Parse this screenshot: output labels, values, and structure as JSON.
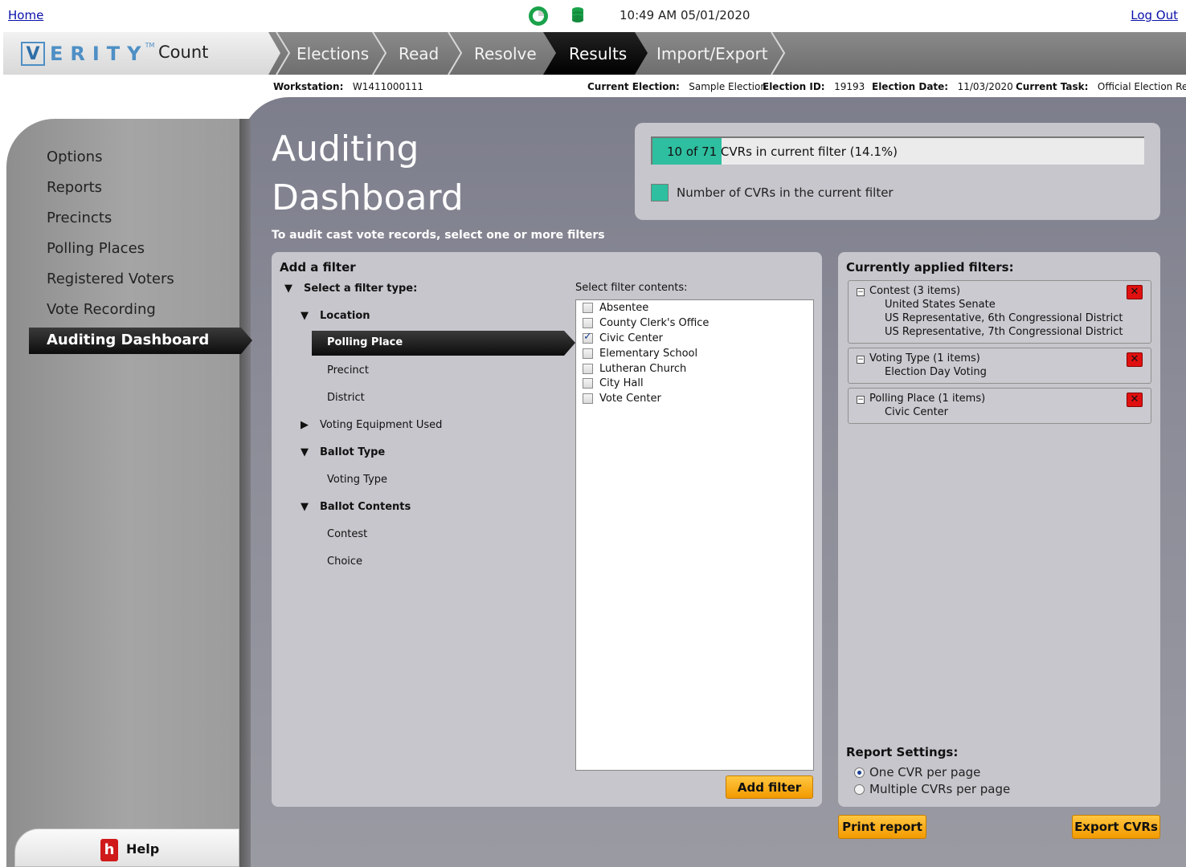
{
  "top": {
    "home_link": "Home",
    "logout_link": "Log Out",
    "clock": "10:49 AM 05/01/2020",
    "sync_icon": "sync-status-icon",
    "db_icon": "database-icon"
  },
  "brand": {
    "logo_letter": "V",
    "logo_rest": "ERITY",
    "logo_tm": "TM",
    "product": "Count"
  },
  "tabs": [
    {
      "label": "Elections",
      "active": false
    },
    {
      "label": "Read",
      "active": false
    },
    {
      "label": "Resolve",
      "active": false
    },
    {
      "label": "Results",
      "active": true
    },
    {
      "label": "Import/Export",
      "active": false
    }
  ],
  "info": {
    "workstation_label": "Workstation:",
    "workstation_value": "W1411000111",
    "election_label": "Current Election:",
    "election_value": "Sample Election",
    "election_id_label": "Election ID:",
    "election_id_value": "19193",
    "election_date_label": "Election Date:",
    "election_date_value": "11/03/2020",
    "task_label": "Current Task:",
    "task_value": "Official Election Results"
  },
  "sidebar": {
    "items": [
      {
        "label": "Options"
      },
      {
        "label": "Reports"
      },
      {
        "label": "Precincts"
      },
      {
        "label": "Polling Places"
      },
      {
        "label": "Registered Voters"
      },
      {
        "label": "Vote Recording"
      }
    ],
    "active_label": "Auditing Dashboard",
    "help_icon_glyph": "h",
    "help_label": "Help"
  },
  "page": {
    "title_line1": "Auditing",
    "title_line2": "Dashboard",
    "instructions": "To audit cast vote records, select one or more filters"
  },
  "summary": {
    "progress_fraction": 0.141,
    "progress_text": "10 of 71 CVRs in current filter (14.1%)",
    "legend_label": "Number of CVRs in the current filter",
    "accent_color": "#2ebfa0"
  },
  "add_filter": {
    "title": "Add a filter",
    "tree": {
      "root_label": "Select a filter type:",
      "location_label": "Location",
      "active_label": "Polling Place",
      "precinct_label": "Precinct",
      "district_label": "District",
      "voting_equipment_label": "Voting Equipment Used",
      "ballot_type_label": "Ballot Type",
      "voting_type_label": "Voting Type",
      "ballot_contents_label": "Ballot Contents",
      "contest_label": "Contest",
      "choice_label": "Choice"
    },
    "contents_label": "Select filter contents:",
    "options": [
      {
        "label": "Absentee",
        "checked": false
      },
      {
        "label": "County Clerk's Office",
        "checked": false
      },
      {
        "label": "Civic Center",
        "checked": true
      },
      {
        "label": "Elementary School",
        "checked": false
      },
      {
        "label": "Lutheran Church",
        "checked": false
      },
      {
        "label": "City Hall",
        "checked": false
      },
      {
        "label": "Vote Center",
        "checked": false
      }
    ],
    "add_button": "Add filter"
  },
  "applied": {
    "title": "Currently applied filters:",
    "filters": [
      {
        "header": "Contest (3 items)",
        "items": [
          "United States Senate",
          "US Representative, 6th Congressional District",
          "US Representative, 7th Congressional District"
        ]
      },
      {
        "header": "Voting Type (1 items)",
        "items": [
          "Election Day Voting"
        ]
      },
      {
        "header": "Polling Place (1 items)",
        "items": [
          "Civic Center"
        ]
      }
    ],
    "remove_glyph": "✕",
    "collapse_glyph": "−",
    "report_settings_label": "Report Settings:",
    "report_options": [
      {
        "label": "One CVR per page",
        "selected": true
      },
      {
        "label": "Multiple CVRs per page",
        "selected": false
      }
    ]
  },
  "footer": {
    "print_button": "Print report",
    "export_button": "Export CVRs"
  }
}
